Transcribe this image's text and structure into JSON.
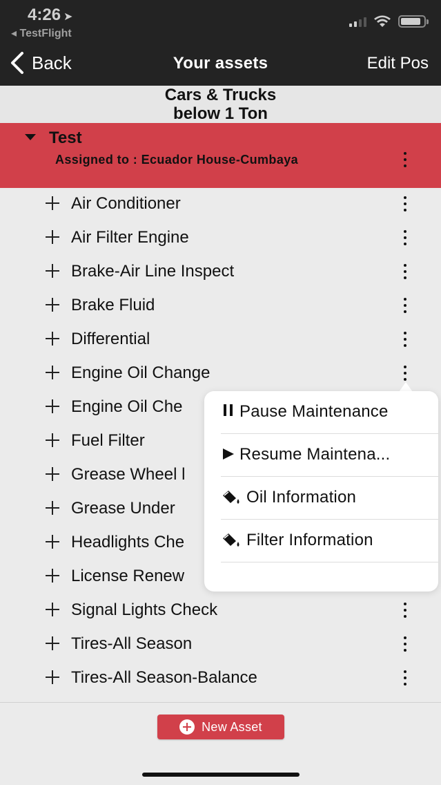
{
  "status_bar": {
    "time": "4:26",
    "location_glyph": "➤",
    "back_app": "◂ TestFlight"
  },
  "nav": {
    "back_label": "Back",
    "title": "Your assets",
    "right_action": "Edit Pos"
  },
  "category": {
    "line1": "Cars & Trucks",
    "line2": "below 1 Ton"
  },
  "asset": {
    "name": "Test",
    "assigned": "Assigned to : Ecuador House-Cumbaya",
    "header_color": "#d1404a"
  },
  "items": [
    {
      "label": "Air Conditioner"
    },
    {
      "label": "Air Filter Engine"
    },
    {
      "label": "Brake-Air Line Inspect"
    },
    {
      "label": "Brake Fluid"
    },
    {
      "label": "Differential"
    },
    {
      "label": "Engine Oil Change"
    },
    {
      "label": "Engine Oil Che"
    },
    {
      "label": "Fuel Filter"
    },
    {
      "label": "Grease Wheel l"
    },
    {
      "label": "Grease Under"
    },
    {
      "label": "Headlights Che"
    },
    {
      "label": "License Renew"
    },
    {
      "label": "Signal Lights Check"
    },
    {
      "label": "Tires-All Season"
    },
    {
      "label": "Tires-All Season-Balance"
    }
  ],
  "menu": {
    "items": [
      {
        "label": "Pause Maintenance",
        "icon": "pause-icon"
      },
      {
        "label": "Resume Maintena...",
        "icon": "play-icon"
      },
      {
        "label": "Oil Information",
        "icon": "oil-can-icon"
      },
      {
        "label": "Filter Information",
        "icon": "oil-can-icon"
      }
    ]
  },
  "footer": {
    "new_asset_label": "New Asset"
  }
}
